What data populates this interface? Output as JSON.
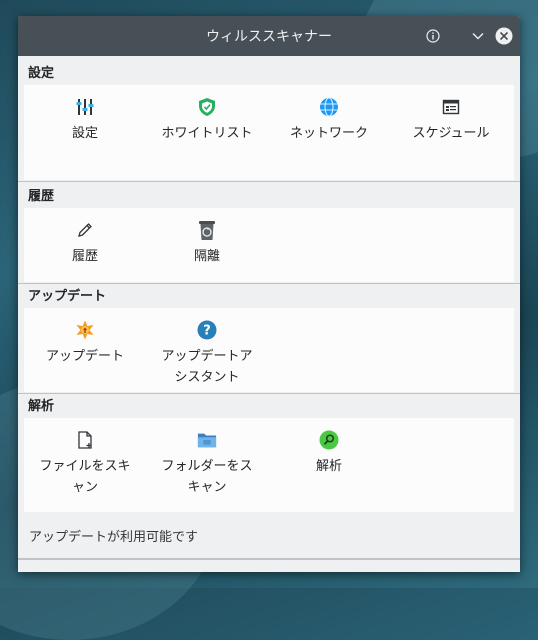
{
  "window": {
    "title": "ウィルススキャナー"
  },
  "sections": {
    "settings": {
      "title": "設定",
      "items": [
        {
          "label": "設定",
          "icon": "settings-sliders-icon"
        },
        {
          "label": "ホワイトリスト",
          "icon": "shield-icon"
        },
        {
          "label": "ネットワーク",
          "icon": "globe-icon"
        },
        {
          "label": "スケジュール",
          "icon": "calendar-icon"
        }
      ]
    },
    "history": {
      "title": "履歴",
      "items": [
        {
          "label": "履歴",
          "icon": "pencil-icon"
        },
        {
          "label": "隔離",
          "icon": "trash-icon"
        }
      ]
    },
    "update": {
      "title": "アップデート",
      "items": [
        {
          "label": "アップデート",
          "icon": "update-star-icon"
        },
        {
          "label": "アップデートアシスタント",
          "icon": "help-icon"
        }
      ]
    },
    "analysis": {
      "title": "解析",
      "items": [
        {
          "label": "ファイルをスキャン",
          "icon": "file-icon"
        },
        {
          "label": "フォルダーをスキャン",
          "icon": "folder-icon"
        },
        {
          "label": "解析",
          "icon": "search-icon"
        }
      ]
    }
  },
  "status": {
    "text": "アップデートが利用可能です"
  },
  "colors": {
    "titlebar": "#475057",
    "window_bg": "#eff0f1",
    "panel_bg": "#fcfcfc",
    "shield_green": "#27ae60",
    "globe_blue": "#1d99f3",
    "help_blue": "#2980b9",
    "search_green": "#4bc843",
    "update_orange": "#f39c1f"
  }
}
